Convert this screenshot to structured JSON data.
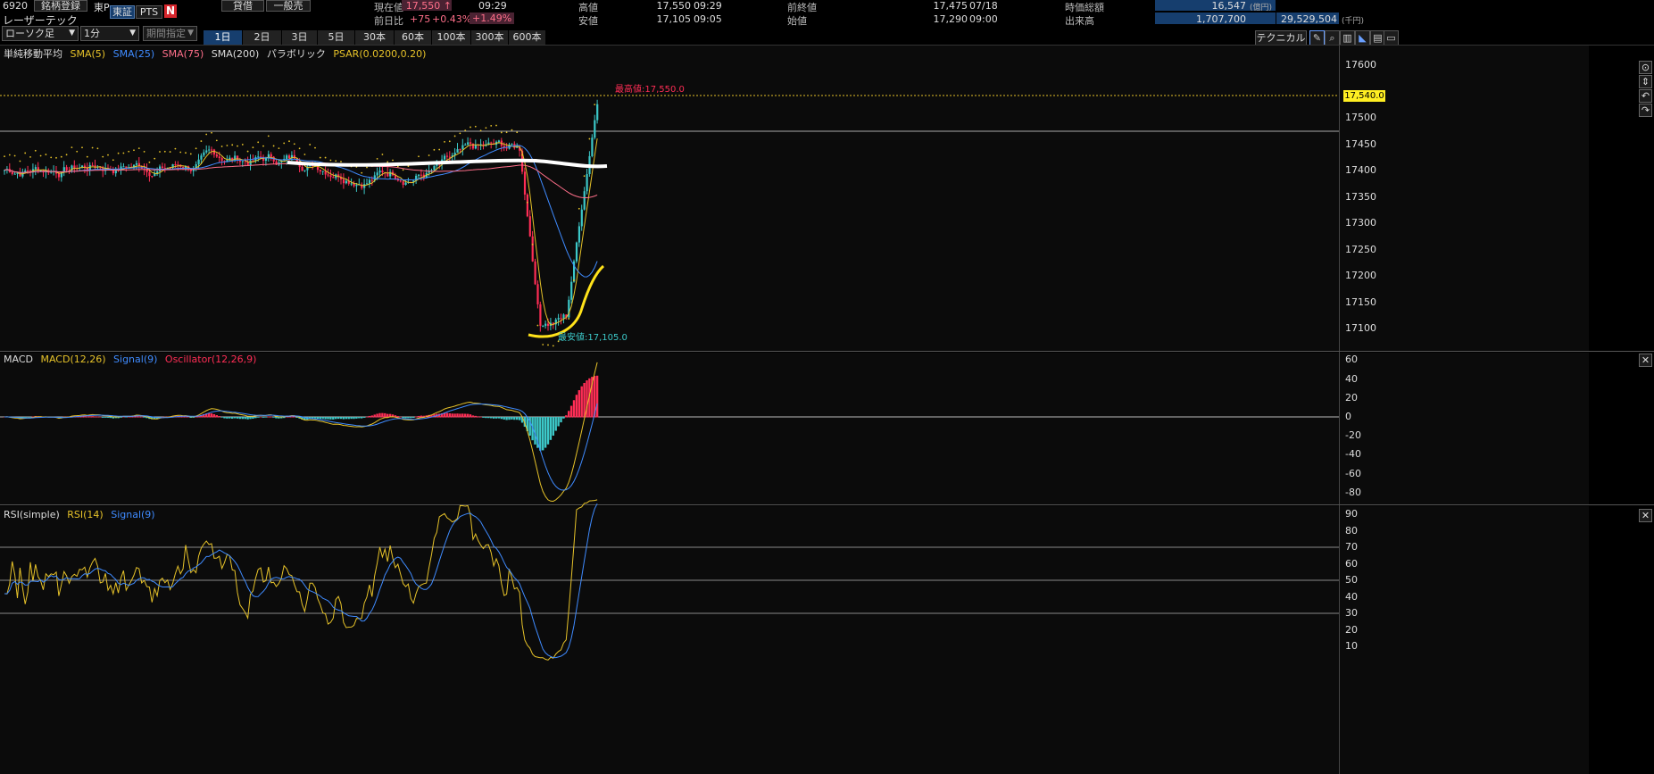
{
  "header": {
    "code": "6920",
    "watchlist_btn": "銘柄登録",
    "market": "東P",
    "exchange_tse": "東証",
    "exchange_pts": "PTS",
    "nikkei_logo": "N",
    "credit_btn": "貸借",
    "general_btn": "一般売",
    "name": "レーザーテック",
    "current_label": "現在値",
    "current_value": "17,550",
    "current_arrow": "↑",
    "current_time": "09:29",
    "change_label": "前日比",
    "change_value": "+75",
    "change_pct": "+0.43%",
    "change_pct2": "+1.49%",
    "high_label": "高値",
    "high_value": "17,550",
    "high_time": "09:29",
    "low_label": "安値",
    "low_value": "17,105",
    "low_time": "09:05",
    "prev_close_label": "前終値",
    "prev_close_value": "17,475",
    "prev_close_date": "07/18",
    "open_label": "始値",
    "open_value": "17,290",
    "open_time": "09:00",
    "mcap_label": "時価総額",
    "mcap_value": "16,547",
    "mcap_unit": "(億円)",
    "volume_label": "出来高",
    "volume_value": "1,707,700",
    "turnover_value": "29,529,504",
    "turnover_unit": "(千円)"
  },
  "toolbar": {
    "chart_type": "ローソク足",
    "interval": "1分",
    "range": "期間指定",
    "periods": [
      "1日",
      "2日",
      "3日",
      "5日",
      "30本",
      "60本",
      "100本",
      "300本",
      "600本"
    ],
    "active_period": "1日",
    "technical_btn": "テクニカル"
  },
  "price_panel": {
    "legend_title": "単純移動平均",
    "sma5": "SMA(5)",
    "sma25": "SMA(25)",
    "sma75": "SMA(75)",
    "sma200": "SMA(200)",
    "parabolic": "パラボリック",
    "psar": "PSAR(0.0200,0.20)",
    "high_annotation": "最高値:17,550.0",
    "low_annotation": "最安値:17,105.0",
    "current_tag": "17,540.0",
    "ticks": [
      "17600",
      "17500",
      "17450",
      "17400",
      "17350",
      "17300",
      "17250",
      "17200",
      "17150",
      "17100"
    ]
  },
  "macd_panel": {
    "title": "MACD",
    "macd": "MACD(12,26)",
    "signal": "Signal(9)",
    "osc": "Oscillator(12,26,9)",
    "ticks": [
      "60",
      "40",
      "20",
      "0",
      "-20",
      "-40",
      "-60",
      "-80"
    ]
  },
  "rsi_panel": {
    "title": "RSI(simple)",
    "rsi": "RSI(14)",
    "signal": "Signal(9)",
    "ticks": [
      "90",
      "80",
      "70",
      "60",
      "50",
      "40",
      "30",
      "20",
      "10"
    ]
  },
  "colors": {
    "sma5": "#e6c229",
    "sma25": "#3f8bff",
    "sma75": "#ff6f8a",
    "up": "#3cc8c8",
    "down": "#ff2d55",
    "accent": "#163e6e"
  }
}
